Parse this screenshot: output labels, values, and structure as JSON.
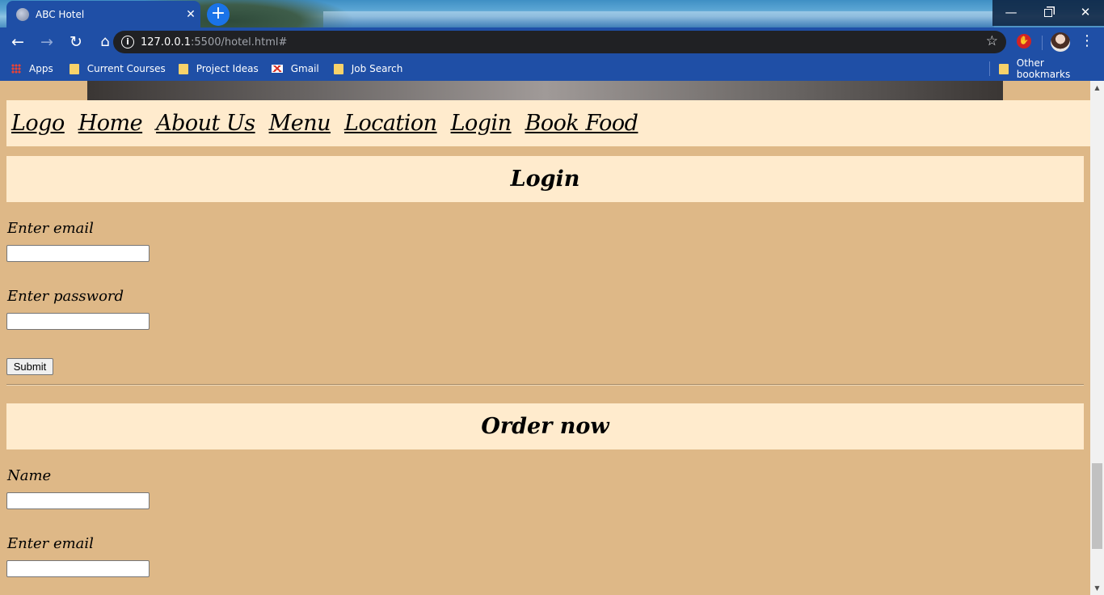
{
  "browser": {
    "tab_title": "ABC Hotel",
    "tab_close": "✕",
    "new_tab": "+",
    "url_host": "127.0.0.1",
    "url_rest": ":5500/hotel.html#",
    "window_controls": {
      "minimize": "—",
      "close": "✕"
    }
  },
  "toolbar": {
    "back": "←",
    "forward": "→",
    "reload": "↻",
    "home": "⌂",
    "star": "☆",
    "menu": "⋮"
  },
  "bookmarks": {
    "items": [
      {
        "label": "Apps",
        "icon": "apps-grid-icon"
      },
      {
        "label": "Current Courses",
        "icon": "folder-icon"
      },
      {
        "label": "Project Ideas",
        "icon": "folder-icon"
      },
      {
        "label": "Gmail",
        "icon": "gmail-icon"
      },
      {
        "label": "Job Search",
        "icon": "folder-icon"
      }
    ],
    "other": "Other bookmarks"
  },
  "nav": {
    "links": [
      "Logo",
      "Home",
      "About Us",
      "Menu",
      "Location",
      "Login",
      "Book Food"
    ]
  },
  "login": {
    "heading": "Login",
    "email_label": "Enter email",
    "email_value": "",
    "password_label": "Enter password",
    "password_value": "",
    "submit_label": "Submit"
  },
  "order": {
    "heading": "Order now",
    "name_label": "Name",
    "name_value": "",
    "email_label": "Enter email",
    "email_value": ""
  },
  "colors": {
    "page_background": "#deb887",
    "section_background": "#ffebcd",
    "chrome_blue": "#1f4fa6"
  }
}
